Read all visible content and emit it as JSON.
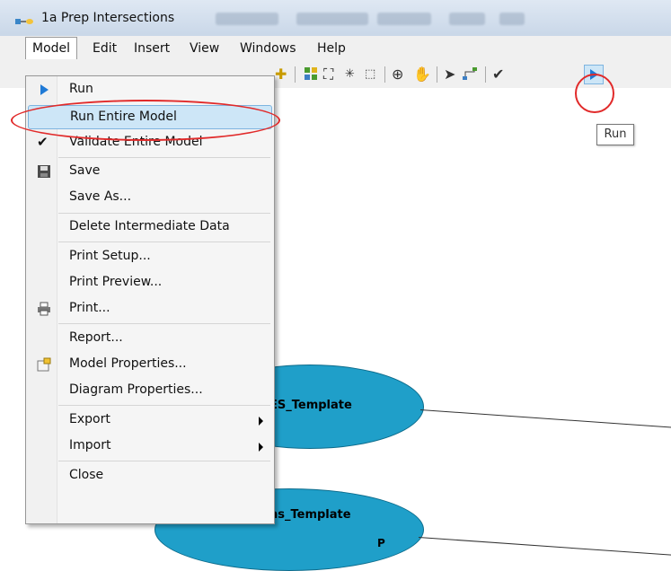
{
  "window": {
    "title": "1a Prep Intersections"
  },
  "menubar": {
    "items": [
      {
        "label": "Model"
      },
      {
        "label": "Edit"
      },
      {
        "label": "Insert"
      },
      {
        "label": "View"
      },
      {
        "label": "Windows"
      },
      {
        "label": "Help"
      }
    ]
  },
  "tooltip": {
    "text": "Run"
  },
  "model_menu": {
    "items": [
      {
        "label": "Run",
        "icon": "play-icon"
      },
      {
        "label": "Run Entire Model",
        "highlighted": true
      },
      {
        "label": "Validate Entire Model",
        "icon": "checkmark-icon"
      },
      {
        "label": "Save",
        "icon": "floppy-disk-icon"
      },
      {
        "label": "Save As..."
      },
      {
        "label": "Delete Intermediate Data"
      },
      {
        "label": "Print Setup..."
      },
      {
        "label": "Print Preview..."
      },
      {
        "label": "Print...",
        "icon": "printer-icon"
      },
      {
        "label": "Report..."
      },
      {
        "label": "Model Properties...",
        "icon": "properties-icon"
      },
      {
        "label": "Diagram Properties..."
      },
      {
        "label": "Export",
        "submenu": true
      },
      {
        "label": "Import",
        "submenu": true
      },
      {
        "label": "Close"
      }
    ]
  },
  "diagram": {
    "ellipses": [
      {
        "label": "ES_Template"
      },
      {
        "label": "ns_Template"
      }
    ],
    "marker": "P"
  },
  "colors": {
    "ellipse_fill": "#1f9fc9",
    "highlight": "#cde6f7",
    "annotation_red": "#e12a2a"
  }
}
